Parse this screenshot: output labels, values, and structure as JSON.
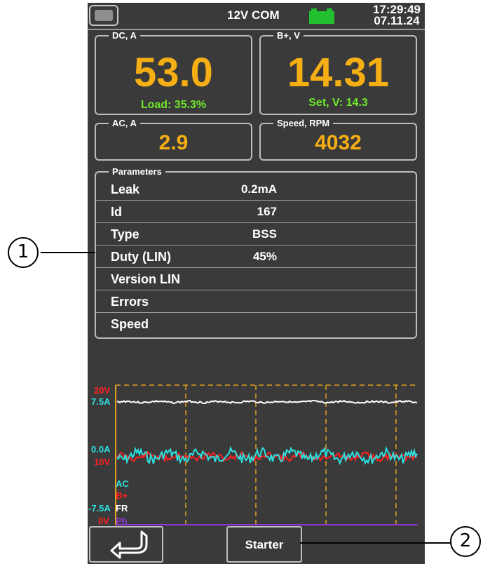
{
  "status_bar": {
    "mode": "12V COM",
    "time": "17:29:49",
    "date": "07.11.24",
    "battery_color": "#22c02e"
  },
  "dc": {
    "label": "DC, A",
    "value": "53.0",
    "sub": "Load: 35.3%"
  },
  "bplus": {
    "label": "B+, V",
    "value": "14.31",
    "sub": "Set, V: 14.3"
  },
  "ac": {
    "label": "AC, A",
    "value": "2.9"
  },
  "speed": {
    "label": "Speed, RPM",
    "value": "4032"
  },
  "parameters": {
    "label": "Parameters",
    "rows": [
      {
        "name": "Leak",
        "value": "0.2mA"
      },
      {
        "name": "Id",
        "value": "167"
      },
      {
        "name": "Type",
        "value": "BSS"
      },
      {
        "name": "Duty (LIN)",
        "value": "45%"
      },
      {
        "name": "Version LIN",
        "value": ""
      },
      {
        "name": "Errors",
        "value": ""
      },
      {
        "name": "Speed",
        "value": ""
      }
    ]
  },
  "chart": {
    "left_labels": {
      "v_top": "20V",
      "a_top": "7.5A",
      "a_mid": "0.0A",
      "v_mid": "10V",
      "a_bot": "-7.5A",
      "v_bot": "0V"
    },
    "legend": [
      {
        "name": "AC",
        "color": "#2ee0e0"
      },
      {
        "name": "B+",
        "color": "#ff2020"
      },
      {
        "name": "FR",
        "color": "#ffffff"
      },
      {
        "name": "Ph",
        "color": "#8a3ad0"
      }
    ],
    "grid_color": "#e0a020"
  },
  "buttons": {
    "back_icon": "return-arrow-icon",
    "starter": "Starter"
  },
  "callouts": {
    "one": "1",
    "two": "2"
  },
  "colors": {
    "value": "#f5ae14",
    "sub": "#6fe82a",
    "panel": "#3a3a3a"
  }
}
